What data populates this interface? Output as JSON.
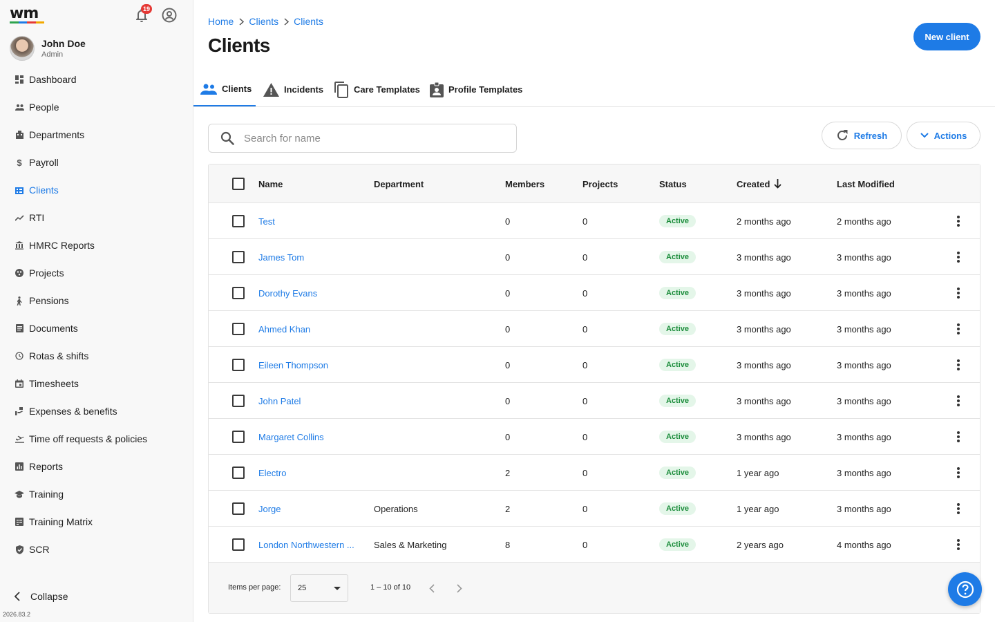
{
  "colors": {
    "accent": "#1e7be6",
    "badge": "#e53935",
    "status_active_bg": "#e4f6e9",
    "status_active_fg": "#1a8c3a",
    "logo_bar": [
      "#2ea44f",
      "#1e7be6",
      "#e53935",
      "#f2a900"
    ]
  },
  "brand": {
    "logo": "wm"
  },
  "header": {
    "notification_count": "19"
  },
  "user": {
    "name": "John Doe",
    "role": "Admin"
  },
  "sidebar": {
    "items": [
      {
        "label": "Dashboard",
        "icon": "dashboard-icon"
      },
      {
        "label": "People",
        "icon": "people-icon"
      },
      {
        "label": "Departments",
        "icon": "building-icon"
      },
      {
        "label": "Payroll",
        "icon": "dollar-icon"
      },
      {
        "label": "Clients",
        "icon": "clients-icon",
        "active": true
      },
      {
        "label": "RTI",
        "icon": "trend-icon"
      },
      {
        "label": "HMRC Reports",
        "icon": "bank-icon"
      },
      {
        "label": "Projects",
        "icon": "projects-icon"
      },
      {
        "label": "Pensions",
        "icon": "pension-icon"
      },
      {
        "label": "Documents",
        "icon": "document-icon"
      },
      {
        "label": "Rotas & shifts",
        "icon": "clock-icon"
      },
      {
        "label": "Timesheets",
        "icon": "calendar-icon"
      },
      {
        "label": "Expenses & benefits",
        "icon": "expenses-icon"
      },
      {
        "label": "Time off requests & policies",
        "icon": "plane-icon"
      },
      {
        "label": "Reports",
        "icon": "reports-icon"
      },
      {
        "label": "Training",
        "icon": "school-icon"
      },
      {
        "label": "Training Matrix",
        "icon": "matrix-icon"
      },
      {
        "label": "SCR",
        "icon": "shield-icon"
      }
    ],
    "collapse_label": "Collapse",
    "version": "2026.83.2"
  },
  "breadcrumb": [
    "Home",
    "Clients",
    "Clients"
  ],
  "page": {
    "title": "Clients",
    "new_button": "New client"
  },
  "tabs": [
    {
      "label": "Clients",
      "icon": "people-icon",
      "active": true
    },
    {
      "label": "Incidents",
      "icon": "warning-icon"
    },
    {
      "label": "Care Templates",
      "icon": "copy-icon"
    },
    {
      "label": "Profile Templates",
      "icon": "badge-icon"
    }
  ],
  "search": {
    "placeholder": "Search for name",
    "value": ""
  },
  "toolbar": {
    "refresh": "Refresh",
    "actions": "Actions"
  },
  "table": {
    "columns": [
      "Name",
      "Department",
      "Members",
      "Projects",
      "Status",
      "Created",
      "Last Modified"
    ],
    "sorted_column": "Created",
    "sort_direction": "desc",
    "rows": [
      {
        "name": "Test",
        "department": "",
        "members": "0",
        "projects": "0",
        "status": "Active",
        "created": "2 months ago",
        "modified": "2 months ago"
      },
      {
        "name": "James Tom",
        "department": "",
        "members": "0",
        "projects": "0",
        "status": "Active",
        "created": "3 months ago",
        "modified": "3 months ago"
      },
      {
        "name": "Dorothy Evans",
        "department": "",
        "members": "0",
        "projects": "0",
        "status": "Active",
        "created": "3 months ago",
        "modified": "3 months ago"
      },
      {
        "name": "Ahmed Khan",
        "department": "",
        "members": "0",
        "projects": "0",
        "status": "Active",
        "created": "3 months ago",
        "modified": "3 months ago"
      },
      {
        "name": "Eileen Thompson",
        "department": "",
        "members": "0",
        "projects": "0",
        "status": "Active",
        "created": "3 months ago",
        "modified": "3 months ago"
      },
      {
        "name": "John Patel",
        "department": "",
        "members": "0",
        "projects": "0",
        "status": "Active",
        "created": "3 months ago",
        "modified": "3 months ago"
      },
      {
        "name": "Margaret Collins",
        "department": "",
        "members": "0",
        "projects": "0",
        "status": "Active",
        "created": "3 months ago",
        "modified": "3 months ago"
      },
      {
        "name": "Electro",
        "department": "",
        "members": "2",
        "projects": "0",
        "status": "Active",
        "created": "1 year ago",
        "modified": "3 months ago"
      },
      {
        "name": "Jorge",
        "department": "Operations",
        "members": "2",
        "projects": "0",
        "status": "Active",
        "created": "1 year ago",
        "modified": "3 months ago"
      },
      {
        "name": "London Northwestern ...",
        "department": "Sales & Marketing",
        "members": "8",
        "projects": "0",
        "status": "Active",
        "created": "2 years ago",
        "modified": "4 months ago"
      }
    ]
  },
  "pagination": {
    "items_per_page_label": "Items per page:",
    "items_per_page": "25",
    "range": "1 – 10 of 10"
  }
}
